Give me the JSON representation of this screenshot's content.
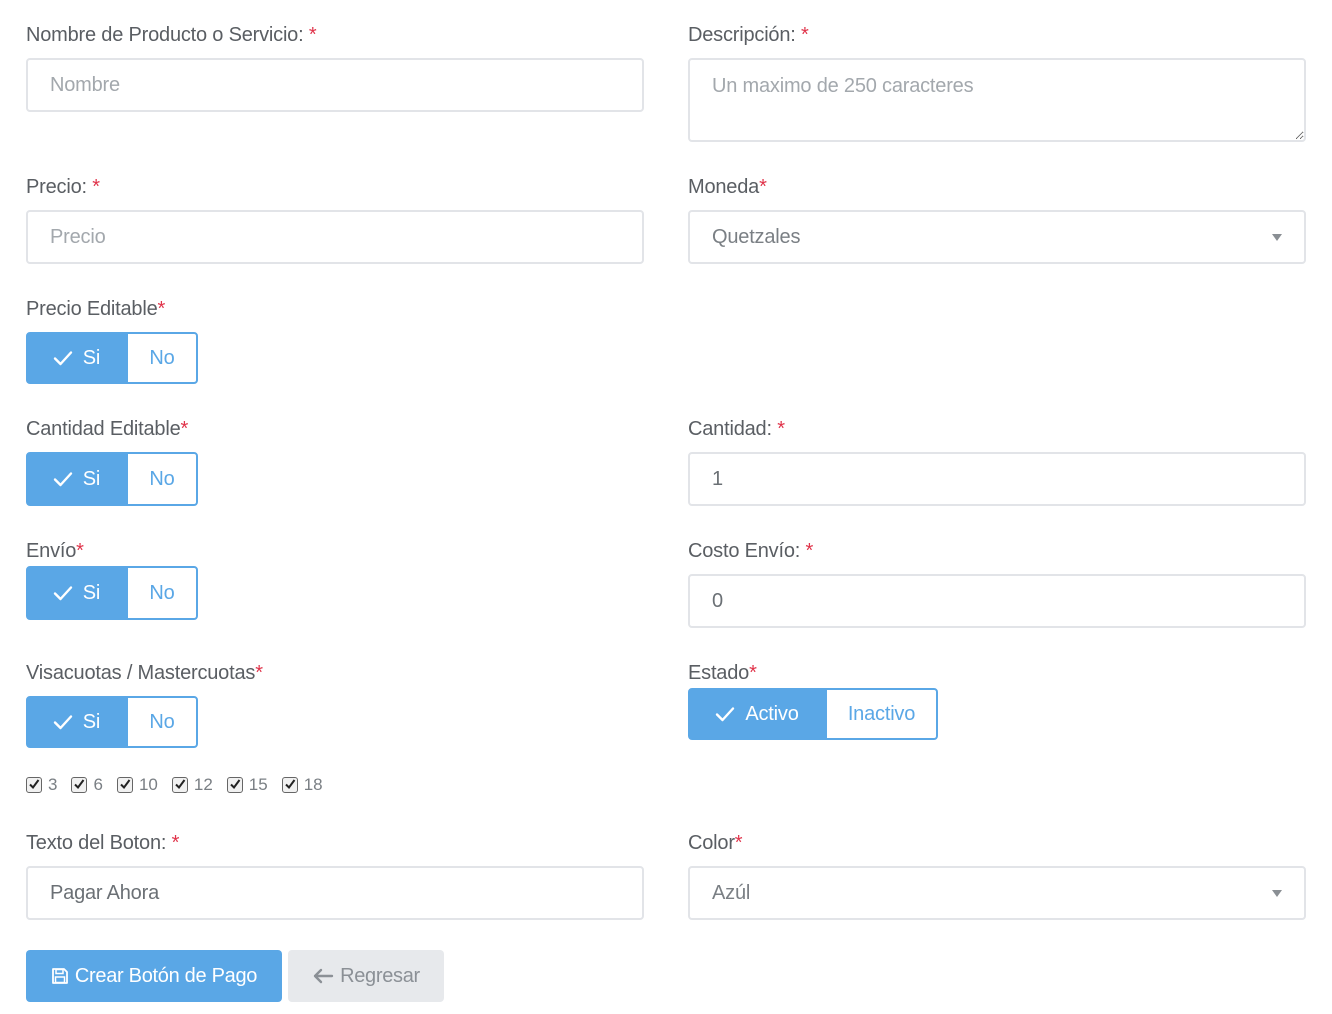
{
  "form": {
    "nombre": {
      "label": "Nombre de Producto o Servicio:",
      "required": "*",
      "placeholder": "Nombre"
    },
    "descripcion": {
      "label": "Descripción:",
      "required": "*",
      "placeholder": "Un maximo de 250 caracteres"
    },
    "precio": {
      "label": "Precio:",
      "required": "*",
      "placeholder": "Precio"
    },
    "moneda": {
      "label": "Moneda",
      "required": "*",
      "value": "Quetzales"
    },
    "precio_editable": {
      "label": "Precio Editable",
      "required": "*",
      "on": "Si",
      "off": "No",
      "selected": "Si"
    },
    "cantidad_editable": {
      "label": "Cantidad Editable",
      "required": "*",
      "on": "Si",
      "off": "No",
      "selected": "Si"
    },
    "cantidad": {
      "label": "Cantidad:",
      "required": "*",
      "value": "1"
    },
    "envio": {
      "label": "Envío",
      "required": "*",
      "on": "Si",
      "off": "No",
      "selected": "Si"
    },
    "costo_envio": {
      "label": "Costo Envío:",
      "required": "*",
      "value": "0"
    },
    "visacuotas": {
      "label": "Visacuotas / Mastercuotas",
      "required": "*",
      "on": "Si",
      "off": "No",
      "selected": "Si"
    },
    "estado": {
      "label": "Estado",
      "required": "*",
      "on": "Activo",
      "off": "Inactivo",
      "selected": "Activo"
    },
    "cuotas": [
      {
        "label": "3",
        "checked": true
      },
      {
        "label": "6",
        "checked": true
      },
      {
        "label": "10",
        "checked": true
      },
      {
        "label": "12",
        "checked": true
      },
      {
        "label": "15",
        "checked": true
      },
      {
        "label": "18",
        "checked": true
      }
    ],
    "texto_boton": {
      "label": "Texto del Boton:",
      "required": "*",
      "value": "Pagar Ahora"
    },
    "color": {
      "label": "Color",
      "required": "*",
      "value": "Azúl"
    }
  },
  "actions": {
    "create_label": "Crear Botón de Pago",
    "create_icon": "floppy-disk-icon",
    "back_label": "Regresar",
    "back_icon": "arrow-left-icon"
  },
  "colors": {
    "accent": "#5aa7e6",
    "required": "#e0334a",
    "border": "#e2e4e8"
  }
}
